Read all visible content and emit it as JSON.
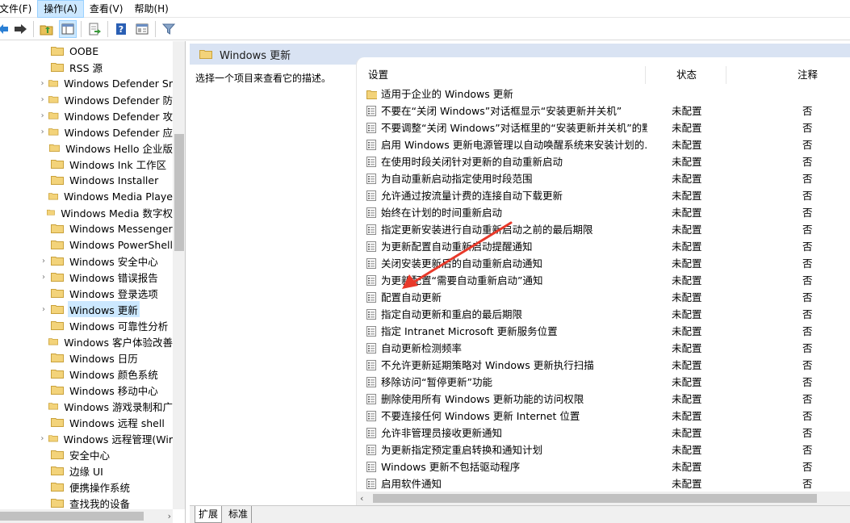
{
  "menu": [
    "文件(F)",
    "操作(A)",
    "查看(V)",
    "帮助(H)"
  ],
  "colors": {
    "selection": "#cce8ff",
    "header_band": "#d9e3f3",
    "folder": "#e8c15a",
    "arrow": "#e8392a"
  },
  "tree": {
    "items": [
      {
        "label": "OOBE",
        "expandable": false
      },
      {
        "label": "RSS 源",
        "expandable": false
      },
      {
        "label": "Windows Defender Sr",
        "expandable": true
      },
      {
        "label": "Windows Defender 防",
        "expandable": true
      },
      {
        "label": "Windows Defender 攻",
        "expandable": true
      },
      {
        "label": "Windows Defender 应",
        "expandable": true
      },
      {
        "label": "Windows Hello 企业版",
        "expandable": false
      },
      {
        "label": "Windows Ink 工作区",
        "expandable": false
      },
      {
        "label": "Windows Installer",
        "expandable": false
      },
      {
        "label": "Windows Media Playe",
        "expandable": false
      },
      {
        "label": "Windows Media 数字权",
        "expandable": false
      },
      {
        "label": "Windows Messenger",
        "expandable": false
      },
      {
        "label": "Windows PowerShell",
        "expandable": false
      },
      {
        "label": "Windows 安全中心",
        "expandable": true
      },
      {
        "label": "Windows 错误报告",
        "expandable": true
      },
      {
        "label": "Windows 登录选项",
        "expandable": false
      },
      {
        "label": "Windows 更新",
        "expandable": true,
        "selected": true
      },
      {
        "label": "Windows 可靠性分析",
        "expandable": false
      },
      {
        "label": "Windows 客户体验改善",
        "expandable": false
      },
      {
        "label": "Windows 日历",
        "expandable": false
      },
      {
        "label": "Windows 颜色系统",
        "expandable": false
      },
      {
        "label": "Windows 移动中心",
        "expandable": false
      },
      {
        "label": "Windows 游戏录制和广",
        "expandable": false
      },
      {
        "label": "Windows 远程 shell",
        "expandable": false
      },
      {
        "label": "Windows 远程管理(Wir",
        "expandable": true
      },
      {
        "label": "安全中心",
        "expandable": false
      },
      {
        "label": "边缘 UI",
        "expandable": false
      },
      {
        "label": "便携操作系统",
        "expandable": false
      },
      {
        "label": "查找我的设备",
        "expandable": false
      }
    ]
  },
  "main": {
    "header_title": "Windows 更新",
    "description": "选择一个项目来查看它的描述。",
    "columns": {
      "setting": "设置",
      "state": "状态",
      "note": "注释"
    },
    "folder_row": "适用于企业的 Windows 更新",
    "rows": [
      {
        "name": "不要在“关闭 Windows”对话框显示“安装更新并关机”",
        "state": "未配置",
        "note": "否"
      },
      {
        "name": "不要调整“关闭 Windows”对话框里的“安装更新并关机”的默...",
        "state": "未配置",
        "note": "否"
      },
      {
        "name": "启用 Windows 更新电源管理以自动唤醒系统来安装计划的...",
        "state": "未配置",
        "note": "否"
      },
      {
        "name": "在使用时段关闭针对更新的自动重新启动",
        "state": "未配置",
        "note": "否"
      },
      {
        "name": "为自动重新启动指定使用时段范围",
        "state": "未配置",
        "note": "否"
      },
      {
        "name": "允许通过按流量计费的连接自动下载更新",
        "state": "未配置",
        "note": "否"
      },
      {
        "name": "始终在计划的时间重新启动",
        "state": "未配置",
        "note": "否"
      },
      {
        "name": "指定更新安装进行自动重新启动之前的最后期限",
        "state": "未配置",
        "note": "否"
      },
      {
        "name": "为更新配置自动重新启动提醒通知",
        "state": "未配置",
        "note": "否"
      },
      {
        "name": "关闭安装更新后的自动重新启动通知",
        "state": "未配置",
        "note": "否"
      },
      {
        "name": "为更新配置“需要自动重新启动”通知",
        "state": "未配置",
        "note": "否"
      },
      {
        "name": "配置自动更新",
        "state": "未配置",
        "note": "否"
      },
      {
        "name": "指定自动更新和重启的最后期限",
        "state": "未配置",
        "note": "否"
      },
      {
        "name": "指定 Intranet Microsoft 更新服务位置",
        "state": "未配置",
        "note": "否"
      },
      {
        "name": "自动更新检测频率",
        "state": "未配置",
        "note": "否"
      },
      {
        "name": "不允许更新延期策略对 Windows 更新执行扫描",
        "state": "未配置",
        "note": "否"
      },
      {
        "name": "移除访问“暂停更新”功能",
        "state": "未配置",
        "note": "否"
      },
      {
        "name": "删除使用所有 Windows 更新功能的访问权限",
        "state": "未配置",
        "note": "否"
      },
      {
        "name": "不要连接任何 Windows 更新 Internet 位置",
        "state": "未配置",
        "note": "否"
      },
      {
        "name": "允许非管理员接收更新通知",
        "state": "未配置",
        "note": "否"
      },
      {
        "name": "为更新指定预定重启转换和通知计划",
        "state": "未配置",
        "note": "否"
      },
      {
        "name": "Windows 更新不包括驱动程序",
        "state": "未配置",
        "note": "否"
      },
      {
        "name": "启用软件通知",
        "state": "未配置",
        "note": "否"
      }
    ]
  },
  "tabs": [
    "扩展",
    "标准"
  ]
}
